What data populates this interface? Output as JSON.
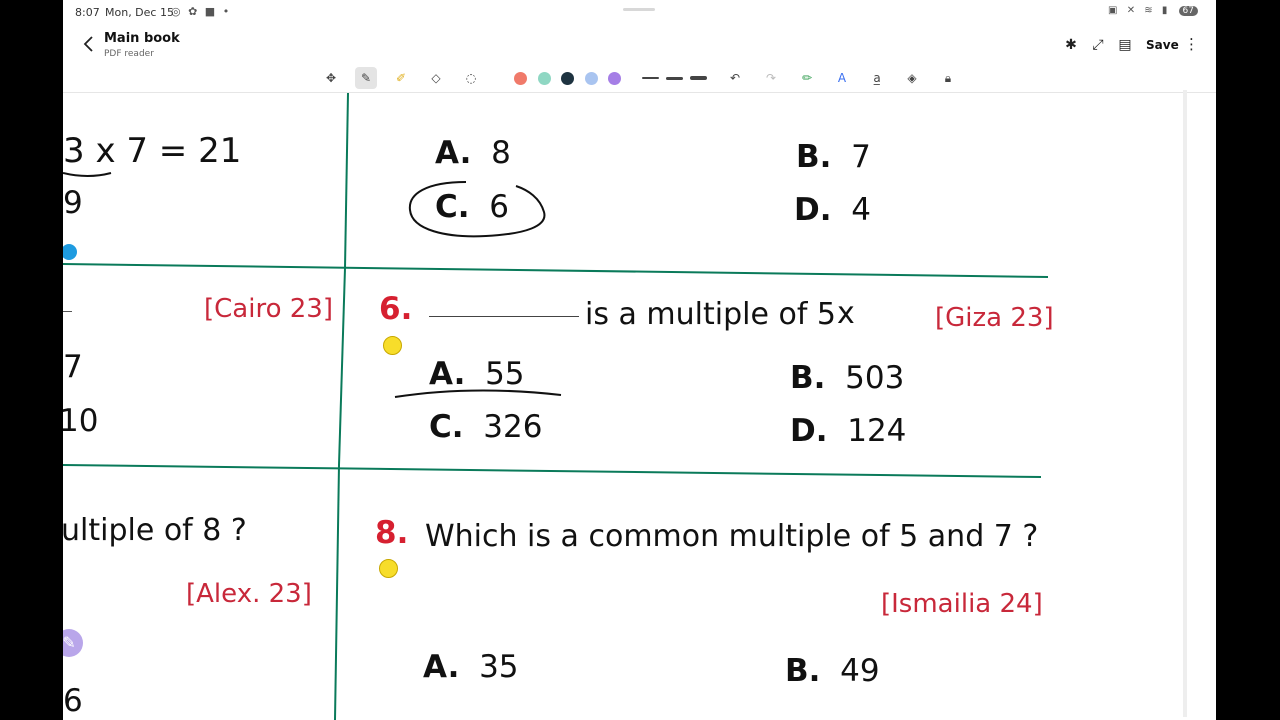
{
  "status_bar": {
    "time": "8:07",
    "date": "Mon, Dec 15",
    "battery": "67"
  },
  "header": {
    "title": "Main book",
    "subtitle": "PDF reader",
    "save_label": "Save"
  },
  "toolbar": {
    "tools": [
      "select-icon",
      "pen-icon",
      "highlighter-icon",
      "eraser-icon",
      "lasso-icon"
    ],
    "colors": [
      "#f07a6a",
      "#8fd7c3",
      "#1e3340",
      "#a9c4f0",
      "#a57ee6"
    ],
    "actions": [
      "undo-icon",
      "redo-icon",
      "pencil-fill-icon",
      "text-icon",
      "text-box-icon",
      "shapes-icon",
      "lock-icon"
    ]
  },
  "content": {
    "left_col": {
      "handwritten_eq": "3 x 7 = 21",
      "num_9": "9",
      "source_cairo": "[Cairo 23]",
      "num_7": "7",
      "num_10": "10",
      "q_partial": "ultiple of 8 ?",
      "source_alex": "[Alex. 23]",
      "num_6": "6"
    },
    "q5_options": {
      "a_letter": "A.",
      "a_value": "8",
      "b_letter": "B.",
      "b_value": "7",
      "c_letter": "C.",
      "c_value": "6",
      "d_letter": "D.",
      "d_value": "4"
    },
    "q6": {
      "number": "6.",
      "text": "is a multiple of 5",
      "mark": "x",
      "source": "[Giza 23]",
      "a_letter": "A.",
      "a_value": "55",
      "b_letter": "B.",
      "b_value": "503",
      "c_letter": "C.",
      "c_value": "326",
      "d_letter": "D.",
      "d_value": "124"
    },
    "q8": {
      "number": "8.",
      "text": "Which is a common multiple of 5 and 7 ?",
      "source": "[Ismailia 24]",
      "a_letter": "A.",
      "a_value": "35",
      "b_letter": "B.",
      "b_value": "49"
    }
  }
}
